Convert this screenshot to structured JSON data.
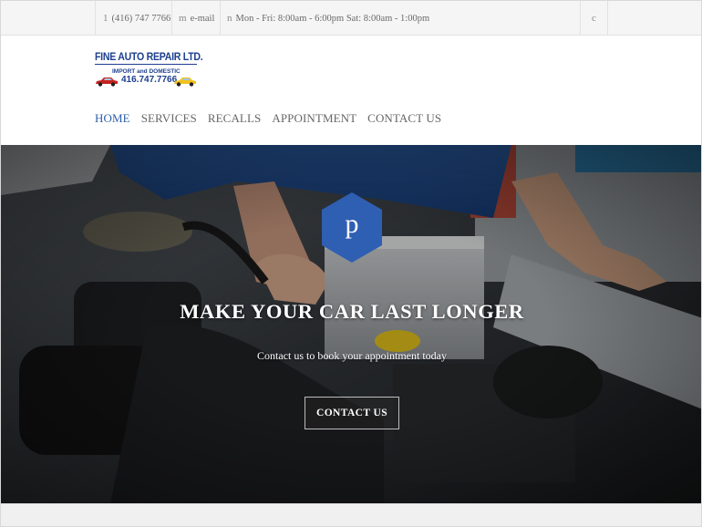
{
  "topbar": {
    "phone_icon": "1",
    "phone": "(416) 747 7766",
    "email_icon": "m",
    "email": "e-mail",
    "hours_icon": "n",
    "hours": "Mon - Fri: 8:00am - 6:00pm Sat: 8:00am - 1:00pm",
    "social_icon": "c"
  },
  "logo": {
    "title": "FINE AUTO REPAIR LTD.",
    "subtitle": "IMPORT and DOMESTIC",
    "phone": "416.747.7766"
  },
  "nav": {
    "items": [
      {
        "label": "HOME",
        "active": true
      },
      {
        "label": "SERVICES",
        "active": false
      },
      {
        "label": "RECALLS",
        "active": false
      },
      {
        "label": "APPOINTMENT",
        "active": false
      },
      {
        "label": "CONTACT US",
        "active": false
      }
    ]
  },
  "hero": {
    "badge_letter": "p",
    "title": "MAKE YOUR CAR LAST LONGER",
    "subtitle": "Contact us to book your appointment today",
    "cta_label": "CONTACT US"
  },
  "colors": {
    "accent": "#2b5fa8",
    "badge": "#2f5fb3",
    "logo_blue": "#1d3f8f"
  }
}
